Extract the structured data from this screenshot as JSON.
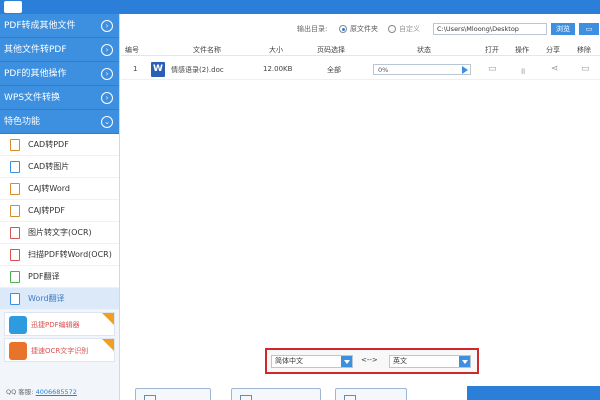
{
  "sidebar": {
    "categories": [
      {
        "label": "PDF转成其他文件"
      },
      {
        "label": "其他文件转PDF"
      },
      {
        "label": "PDF的其他操作"
      },
      {
        "label": "WPS文件转换"
      },
      {
        "label": "特色功能"
      }
    ],
    "items": [
      {
        "label": "CAD转PDF"
      },
      {
        "label": "CAD转图片"
      },
      {
        "label": "CAJ转Word"
      },
      {
        "label": "CAJ转PDF"
      },
      {
        "label": "图片转文字(OCR)"
      },
      {
        "label": "扫描PDF转Word(OCR)"
      },
      {
        "label": "PDF翻译"
      },
      {
        "label": "Word翻译"
      }
    ],
    "promos": [
      {
        "label": "迅捷PDF编辑器"
      },
      {
        "label": "捷速OCR文字识别"
      }
    ],
    "contact": {
      "prefix": "QQ 客服:",
      "number": "4006685572"
    }
  },
  "output": {
    "label": "输出目录:",
    "option_source": "原文件夹",
    "option_custom": "自定义",
    "path": "C:\\Users\\Mloong\\Desktop",
    "browse_label": "浏览"
  },
  "table": {
    "headers": {
      "index": "编号",
      "name": "文件名称",
      "size": "大小",
      "pages": "页码选择",
      "status": "状态",
      "open": "打开",
      "action": "操作",
      "share": "分享",
      "remove": "移除"
    },
    "rows": [
      {
        "index": "1",
        "name": "情感语录(2).doc",
        "size": "12.00KB",
        "pages": "全部",
        "progress": "0%",
        "progress_value": 0
      }
    ]
  },
  "translate": {
    "from": "简体中文",
    "swap": "<-->",
    "to": "英文"
  },
  "colors": {
    "accent": "#3d8fe0",
    "highlight_border": "#cc2a2a"
  }
}
